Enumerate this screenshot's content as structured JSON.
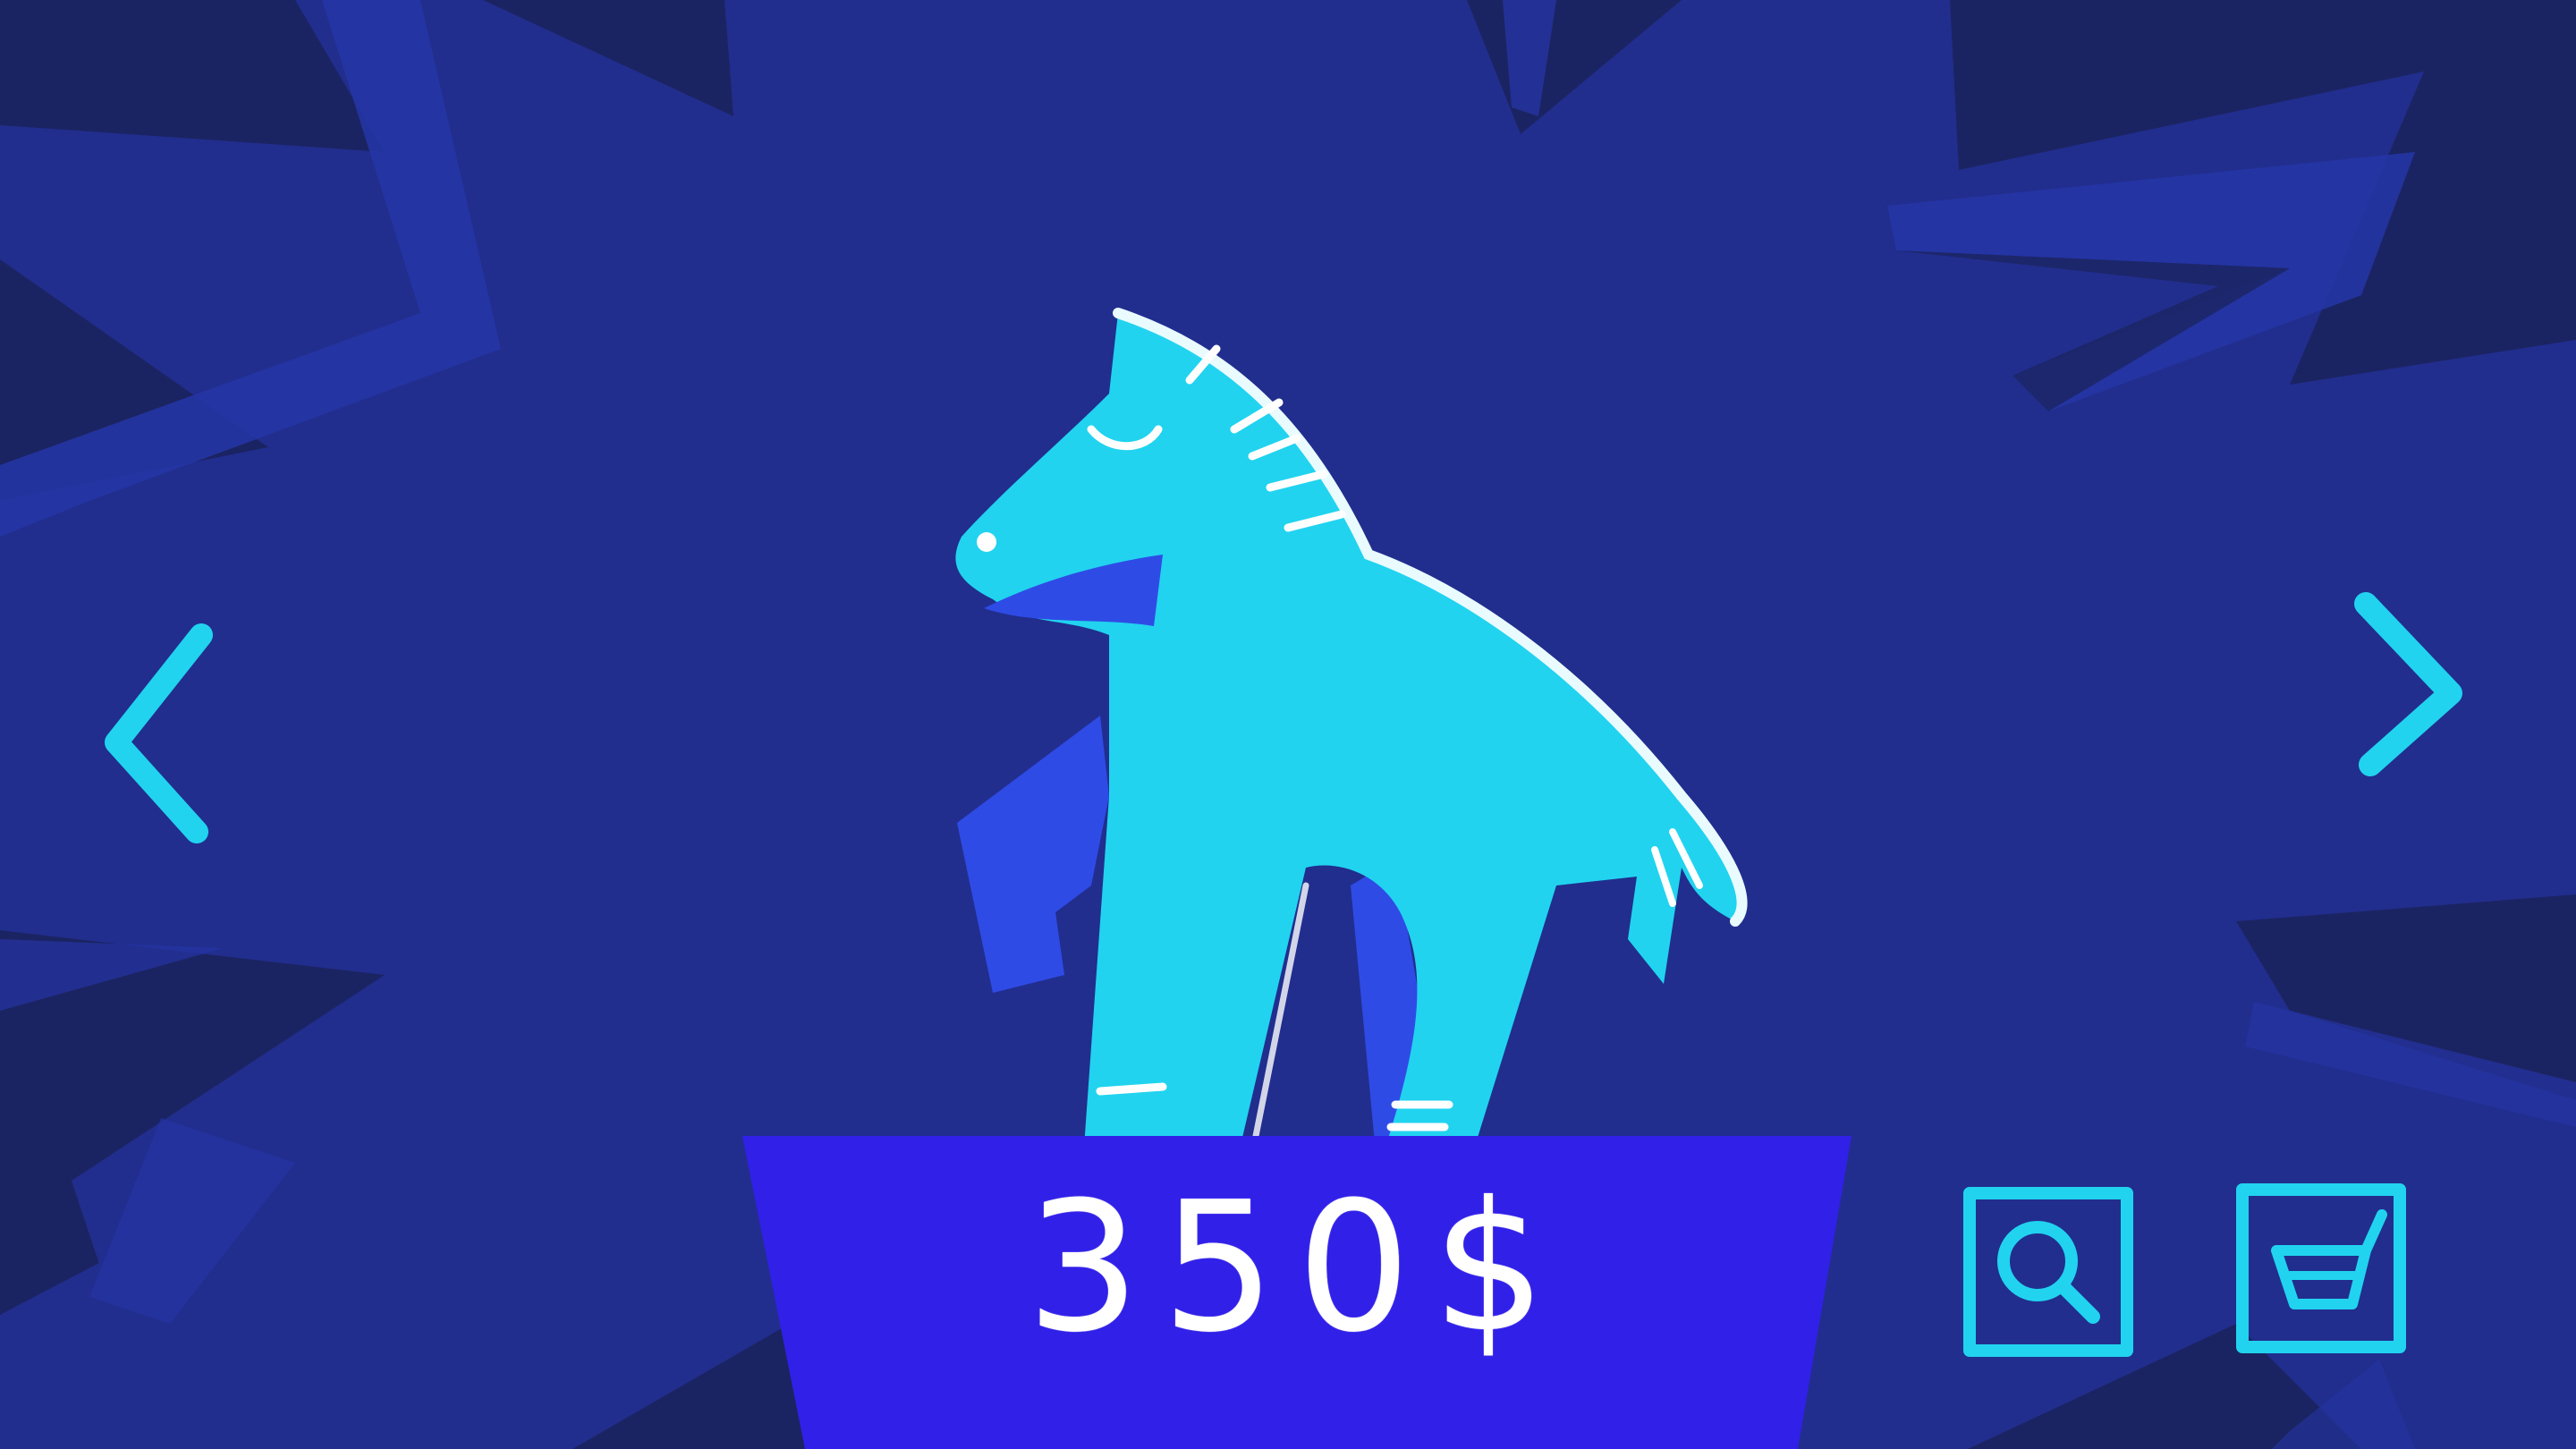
{
  "product": {
    "name_icon": "horse-figure-icon",
    "price": "350$"
  },
  "navigation": {
    "prev_icon": "chevron-left-icon",
    "next_icon": "chevron-right-icon"
  },
  "actions": {
    "search_icon": "search-icon",
    "cart_icon": "basket-icon"
  },
  "colors": {
    "background_dark": "#1b2462",
    "burst": "#212e8e",
    "accent_cyan": "#21d3ef",
    "plinth": "#3120e8",
    "text": "#ffffff"
  }
}
